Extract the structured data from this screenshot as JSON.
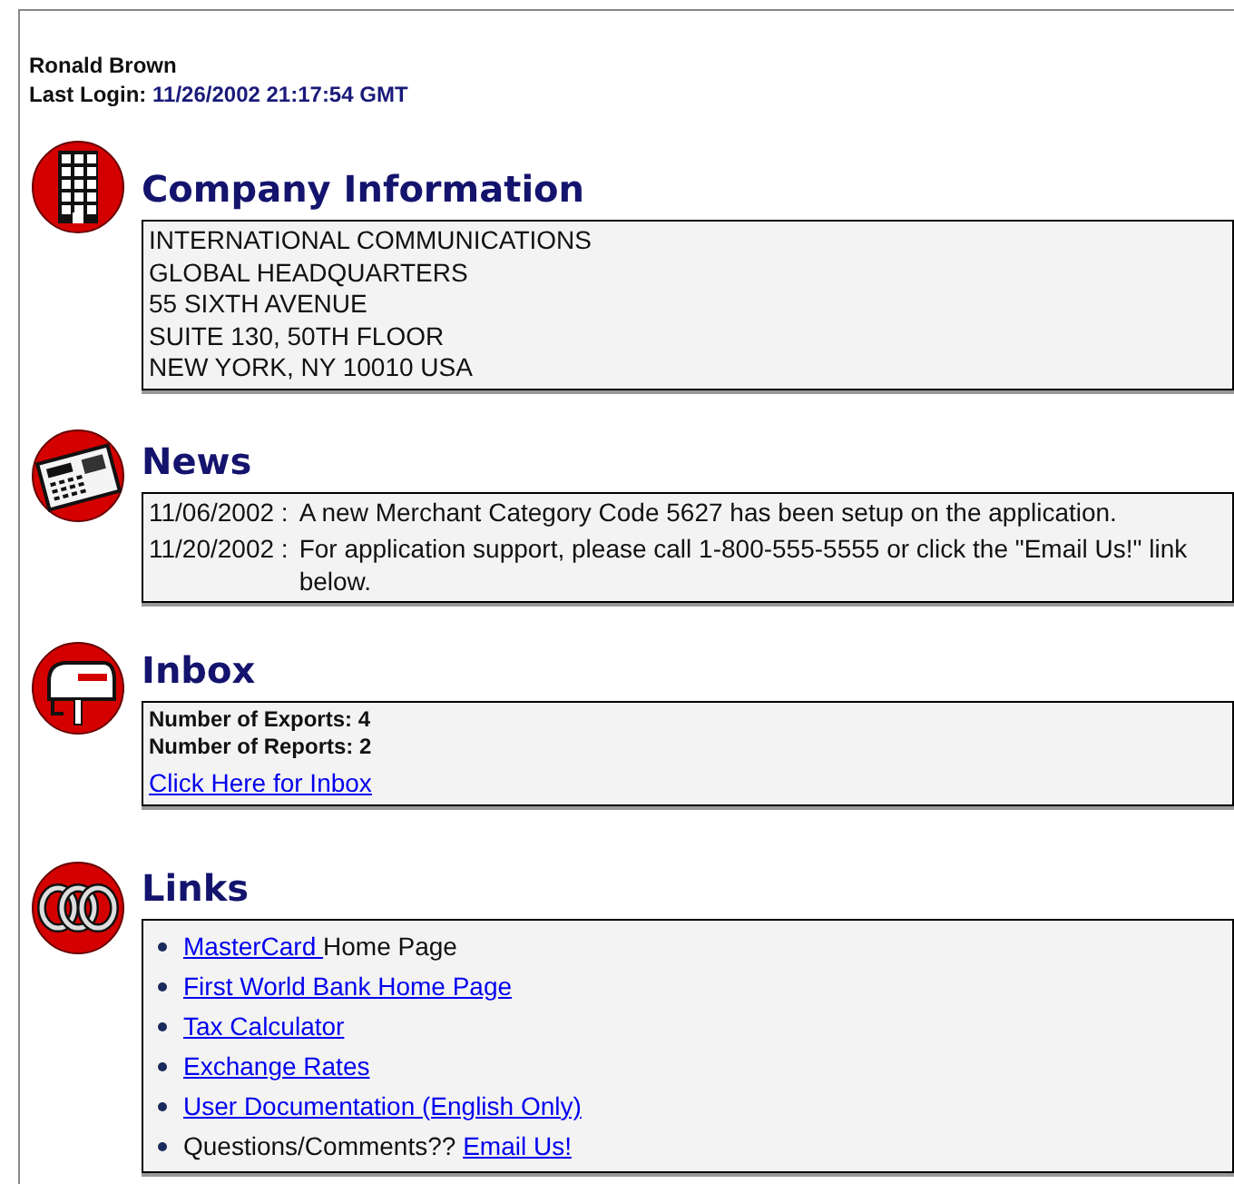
{
  "user": {
    "name": "Ronald Brown",
    "last_login_label": "Last Login:",
    "last_login": "11/26/2002 21:17:54 GMT"
  },
  "sections": [
    {
      "kind": "company",
      "title": "Company Information",
      "lines": [
        "INTERNATIONAL COMMUNICATIONS",
        "GLOBAL HEADQUARTERS",
        "55 SIXTH AVENUE",
        "SUITE 130, 50TH FLOOR",
        "NEW YORK, NY 10010 USA"
      ]
    },
    {
      "kind": "news",
      "title": "News",
      "items": [
        {
          "date": "11/06/2002 :",
          "text": "A new Merchant Category Code 5627 has been setup on the application."
        },
        {
          "date": "11/20/2002 :",
          "text": "For application support, please call 1-800-555-5555 or click the \"Email Us!\" link below."
        }
      ]
    },
    {
      "kind": "inbox",
      "title": "Inbox",
      "counts": [
        "Number of Exports: 4",
        "Number of Reports: 2"
      ],
      "link": "Click Here for Inbox"
    },
    {
      "kind": "links",
      "title": "Links",
      "items": [
        [
          {
            "kind": "link",
            "text": "MasterCard "
          },
          {
            "kind": "text",
            "text": "Home Page"
          }
        ],
        [
          {
            "kind": "link",
            "text": "First World Bank Home Page"
          }
        ],
        [
          {
            "kind": "link",
            "text": "Tax Calculator"
          }
        ],
        [
          {
            "kind": "link",
            "text": "Exchange Rates"
          }
        ],
        [
          {
            "kind": "link",
            "text": "User Documentation (English Only)"
          }
        ],
        [
          {
            "kind": "text",
            "text": "Questions/Comments?? "
          },
          {
            "kind": "link",
            "text": "Email Us!"
          }
        ]
      ]
    }
  ]
}
